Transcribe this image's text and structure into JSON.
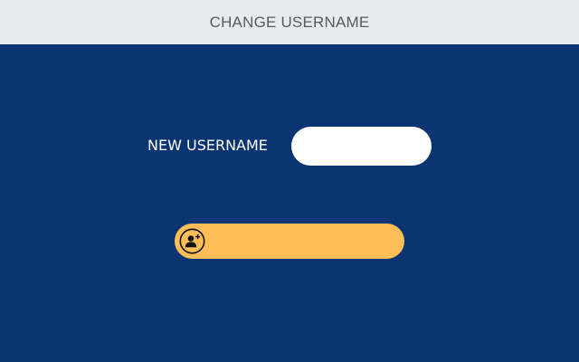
{
  "header": {
    "title": "CHANGE USERNAME"
  },
  "form": {
    "label": "NEW USERNAME",
    "input_value": "",
    "input_placeholder": ""
  },
  "submit": {
    "icon": "add-user-icon"
  },
  "colors": {
    "header_bg": "#e9eaee",
    "page_bg": "#0b3572",
    "button_bg": "#ffbe57",
    "input_bg": "#ffffff",
    "label_text": "#ffffff"
  }
}
